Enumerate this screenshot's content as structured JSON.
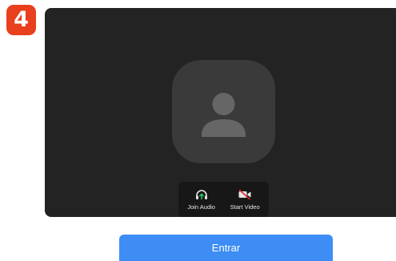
{
  "step_badge": {
    "number": "4",
    "color": "#e8401c"
  },
  "preview": {
    "avatar_icon": "user-silhouette-icon",
    "controls": [
      {
        "label": "Join Audio",
        "icon": "headphones-icon",
        "icon_color": "#2bbd5b"
      },
      {
        "label": "Start Video",
        "icon": "video-off-icon",
        "icon_color": "#e02828"
      }
    ]
  },
  "primary_button": {
    "label": "Entrar",
    "color": "#3d8df5"
  }
}
